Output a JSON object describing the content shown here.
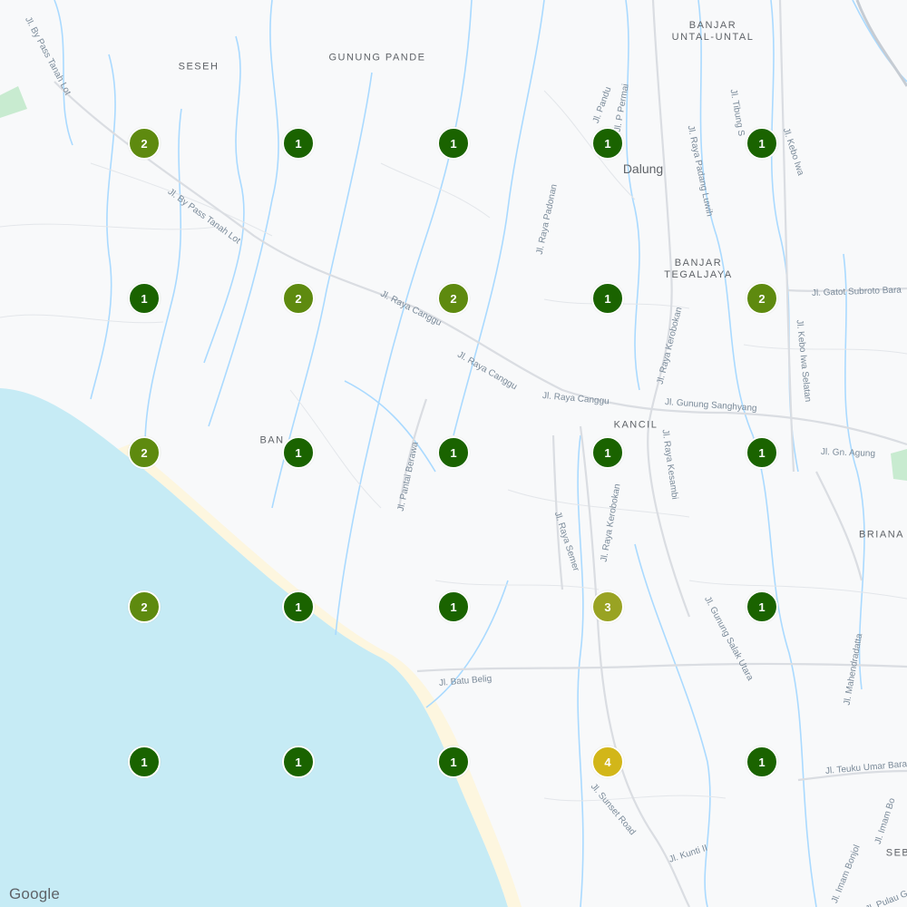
{
  "map": {
    "colors": {
      "land": "#f8f9fa",
      "water": "#c6ebf5",
      "river": "#aadaff",
      "road": "#dfe3e8",
      "beach": "#fdf6df",
      "park": "#c8ebd0",
      "cluster_1": "#1a6300",
      "cluster_2": "#5e8a0f",
      "cluster_3": "#99a323",
      "cluster_4": "#d2b619"
    },
    "area_labels": {
      "banjar_untal_untal": "BANJAR\nUNTAL-UNTAL",
      "seseh": "SESEH",
      "gunung_pande": "GUNUNG PANDE",
      "banjar_tegaljaya": "BANJAR\nTEGALJAYA",
      "kancil": "KANCIL",
      "briana": "BRIANA",
      "banjar_left": "BAN",
      "sebe": "SEB"
    },
    "town_labels": {
      "dalung": "Dalung"
    },
    "road_labels": {
      "bypass_tanah_lot_1": "Jl. By Pass Tanah Lot",
      "bypass_tanah_lot_2": "Jl. By Pass Tanah Lot",
      "raya_canggu_1": "Jl. Raya Canggu",
      "raya_canggu_2": "Jl. Raya Canggu",
      "raya_canggu_3": "Jl. Raya Canggu",
      "pandu": "Jl. Pandu",
      "p_permai": "Jl. P Permai",
      "tibung": "Jl. Tibung S",
      "kebo_iwa": "Jl. Kebo Iwa",
      "raya_padang_luwih": "Jl. Raya Padang Luwih",
      "raya_padonan": "Jl. Raya Padonan",
      "gatot_subroto": "Jl. Gatot Subroto Bara",
      "kebo_iwa_selatan": "Jl. Kebo Iwa Selatan",
      "raya_kerobokan_1": "Jl. Raya Kerobokan",
      "raya_kerobokan_2": "Jl. Raya Kerobokan",
      "gunung_sanghyang": "Jl. Gunung Sanghyang",
      "raya_kesambi": "Jl. Raya Kesambi",
      "gn_agung": "Jl. Gn. Agung",
      "pantai_berawa": "Jl. Pantai Berawa",
      "raya_semer": "Jl. Raya Semer",
      "gunung_salak_utara": "Jl. Gunung Salak Utara",
      "mahendradatta": "Jl. Mahendradatta",
      "batu_belig": "Jl. Batu Belig",
      "teuku_umar": "Jl. Teuku Umar Bara",
      "imam_bonjol_1": "Jl. Imam Bo",
      "sunset_road": "Jl. Sunset Road",
      "kunti": "Jl. Kunti II",
      "imam_bonjol_2": "Jl. Imam Bonjol",
      "pulau_gadung": "Jl. Pulau Gad"
    },
    "clusters": [
      {
        "count": "2",
        "level": 2
      },
      {
        "count": "1",
        "level": 1
      },
      {
        "count": "1",
        "level": 1
      },
      {
        "count": "1",
        "level": 1
      },
      {
        "count": "1",
        "level": 1
      },
      {
        "count": "1",
        "level": 1
      },
      {
        "count": "2",
        "level": 2
      },
      {
        "count": "2",
        "level": 2
      },
      {
        "count": "1",
        "level": 1
      },
      {
        "count": "2",
        "level": 2
      },
      {
        "count": "2",
        "level": 2
      },
      {
        "count": "1",
        "level": 1
      },
      {
        "count": "1",
        "level": 1
      },
      {
        "count": "1",
        "level": 1
      },
      {
        "count": "1",
        "level": 1
      },
      {
        "count": "2",
        "level": 2
      },
      {
        "count": "1",
        "level": 1
      },
      {
        "count": "1",
        "level": 1
      },
      {
        "count": "3",
        "level": 3
      },
      {
        "count": "1",
        "level": 1
      },
      {
        "count": "1",
        "level": 1
      },
      {
        "count": "1",
        "level": 1
      },
      {
        "count": "1",
        "level": 1
      },
      {
        "count": "4",
        "level": 4
      },
      {
        "count": "1",
        "level": 1
      }
    ],
    "attribution": "Google"
  }
}
